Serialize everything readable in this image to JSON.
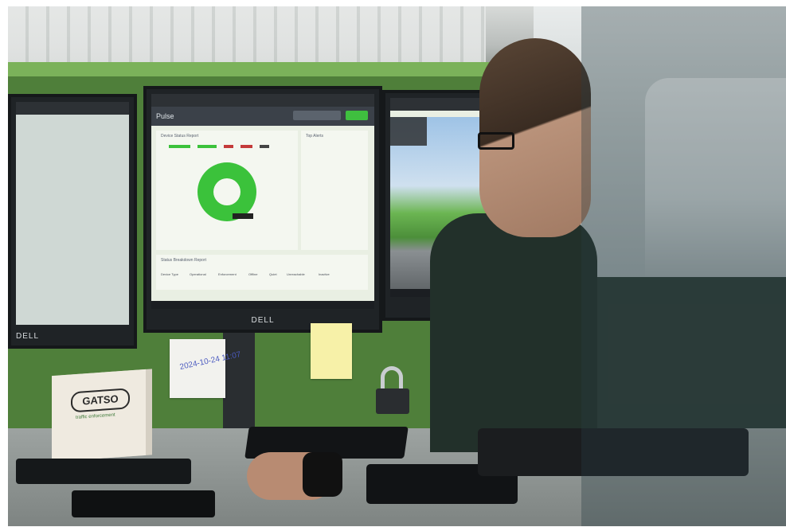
{
  "photo": {
    "description_tags": [
      "office-desk",
      "monitors",
      "person-at-workstation"
    ],
    "monitor_brand": "DELL",
    "center_monitor": {
      "app_name": "Pulse",
      "panels": {
        "device_status_title": "Device Status Report",
        "side_title": "Top Alerts",
        "bottom_title": "Status Breakdown Report"
      },
      "table_headers": [
        "Device Type",
        "Operational",
        "Enforcement",
        "Offline",
        "Quiet",
        "Unreachable",
        "Inactive"
      ],
      "donut_color": "#3bc23b"
    },
    "sticky_note_text": "2024-10-24 11:07",
    "box_brand": "GATSO",
    "box_subtitle": "traffic enforcement"
  }
}
